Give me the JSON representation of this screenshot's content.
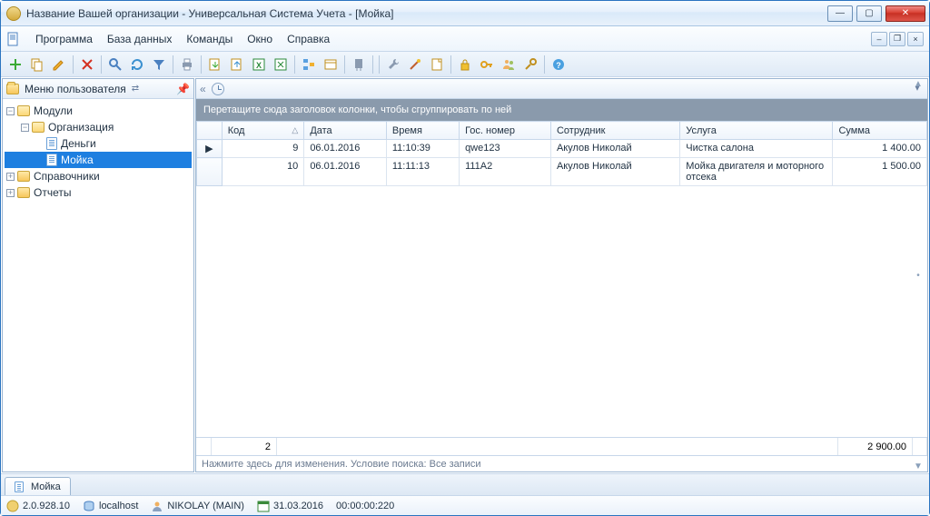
{
  "window": {
    "title": "Название Вашей организации - Универсальная Система Учета - [Мойка]"
  },
  "menu": {
    "items": [
      "Программа",
      "База данных",
      "Команды",
      "Окно",
      "Справка"
    ]
  },
  "sidebar": {
    "title": "Меню пользователя",
    "tree": {
      "modules": "Модули",
      "org": "Организация",
      "money": "Деньги",
      "wash": "Мойка",
      "refs": "Справочники",
      "reports": "Отчеты"
    }
  },
  "grid": {
    "group_hint": "Перетащите сюда заголовок колонки, чтобы сгруппировать по ней",
    "columns": [
      "Код",
      "Дата",
      "Время",
      "Гос. номер",
      "Сотрудник",
      "Услуга",
      "Сумма"
    ],
    "rows": [
      {
        "code": "9",
        "date": "06.01.2016",
        "time": "11:10:39",
        "plate": "qwe123",
        "employee": "Акулов Николай",
        "service": "Чистка салона",
        "amount": "1 400.00"
      },
      {
        "code": "10",
        "date": "06.01.2016",
        "time": "11:11:13",
        "plate": "111A2",
        "employee": "Акулов Николай",
        "service": "Мойка двигателя и моторного отсека",
        "amount": "1 500.00"
      }
    ],
    "footer_count": "2",
    "footer_sum": "2 900.00",
    "status": "Нажмите здесь для изменения. Условие поиска: Все записи"
  },
  "tabs": {
    "wash": "Мойка"
  },
  "statusbar": {
    "version": "2.0.928.10",
    "host": "localhost",
    "user": "NIKOLAY (MAIN)",
    "date": "31.03.2016",
    "timer": "00:00:00:220"
  }
}
